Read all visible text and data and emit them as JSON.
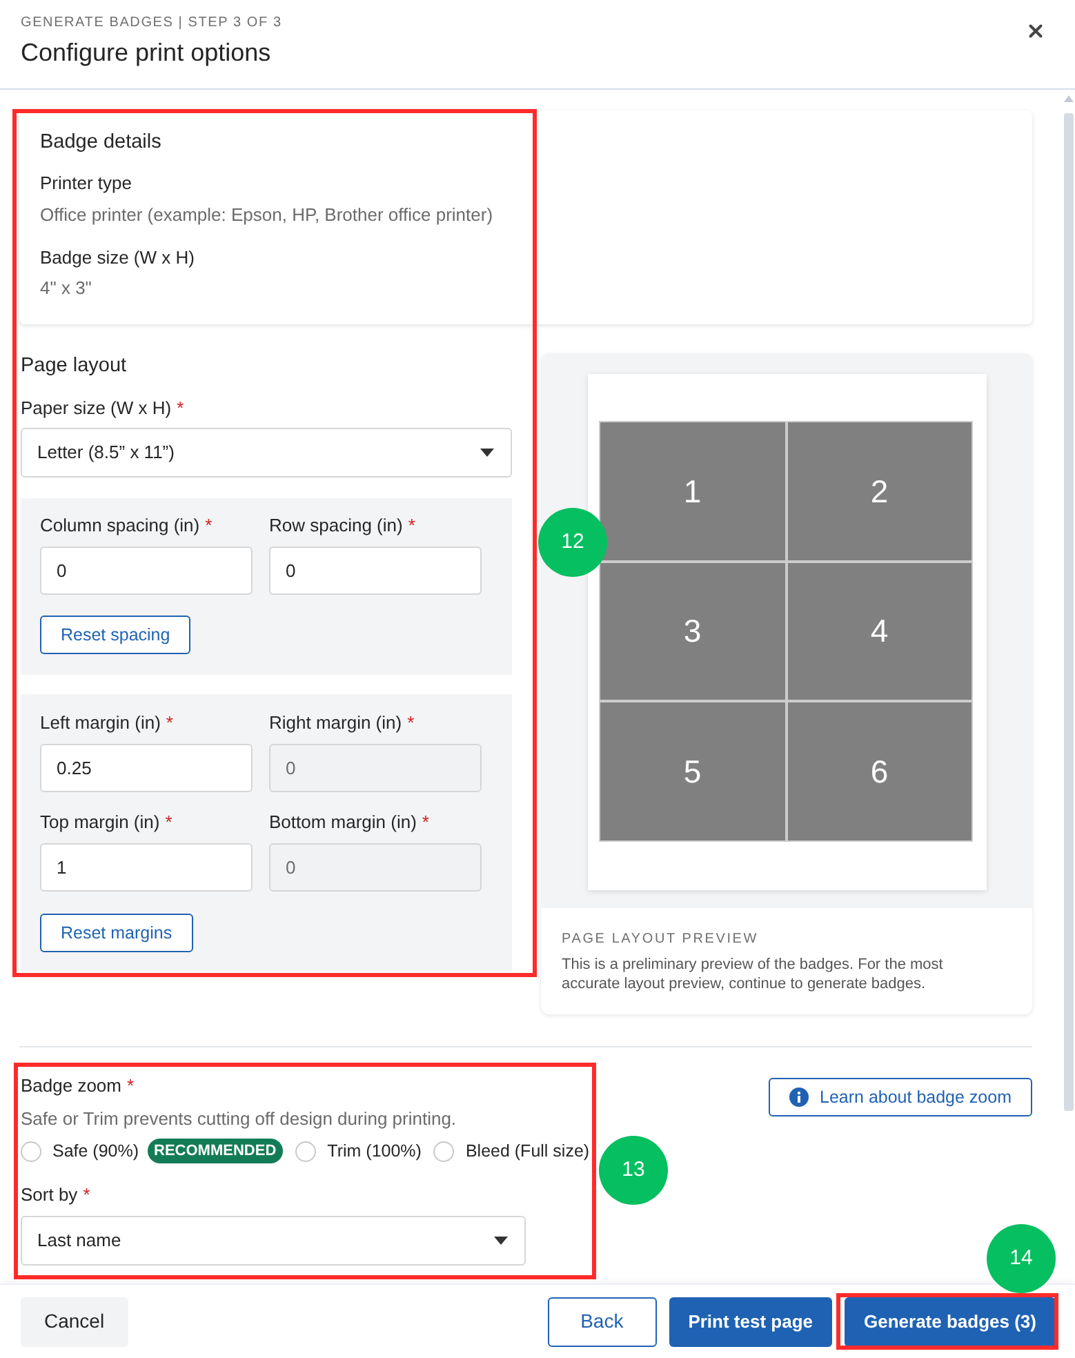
{
  "header": {
    "eyebrow": "GENERATE BADGES | STEP 3 OF 3",
    "title": "Configure print options"
  },
  "badge_details": {
    "title": "Badge details",
    "fields": [
      {
        "label": "Printer type",
        "value": "Office printer (example: Epson, HP, Brother office printer)"
      },
      {
        "label": "Badge size (W x H)",
        "value": "4\" x 3\""
      }
    ]
  },
  "page_layout": {
    "title": "Page layout",
    "paper_size": {
      "label": "Paper size (W x H)",
      "required_mark": "*",
      "value": "Letter (8.5” x 11”)"
    },
    "spacing_group": {
      "fields": [
        {
          "label": "Column spacing (in)",
          "required_mark": "*",
          "value": "0",
          "disabled": false
        },
        {
          "label": "Row spacing (in)",
          "required_mark": "*",
          "value": "0",
          "disabled": false
        }
      ],
      "reset_button": "Reset spacing"
    },
    "margin_group": {
      "fields": [
        {
          "label": "Left margin (in)",
          "required_mark": "*",
          "value": "0.25",
          "disabled": false
        },
        {
          "label": "Right margin (in)",
          "required_mark": "*",
          "value": "0",
          "disabled": true
        },
        {
          "label": "Top margin (in)",
          "required_mark": "*",
          "value": "1",
          "disabled": false
        },
        {
          "label": "Bottom margin (in)",
          "required_mark": "*",
          "value": "0",
          "disabled": true
        }
      ],
      "reset_button": "Reset margins"
    }
  },
  "preview": {
    "cells": [
      "1",
      "2",
      "3",
      "4",
      "5",
      "6"
    ],
    "caption_title": "PAGE LAYOUT PREVIEW",
    "caption": "This is a preliminary preview of the badges. For the most accurate layout preview, continue to generate badges."
  },
  "badge_zoom": {
    "label": "Badge zoom",
    "required_mark": "*",
    "hint": "Safe or Trim prevents cutting off design during printing.",
    "options": [
      {
        "label": "Safe (90%)",
        "selected": false,
        "tag": "RECOMMENDED"
      },
      {
        "label": "Trim (100%)",
        "selected": false
      },
      {
        "label": "Bleed (Full size)",
        "selected": false
      }
    ],
    "learn_button": "Learn about badge zoom"
  },
  "sort_by": {
    "label": "Sort by",
    "required_mark": "*",
    "value": "Last name"
  },
  "footer": {
    "buttons": [
      {
        "label": "Cancel",
        "kind": "secondary"
      },
      {
        "label": "Back",
        "kind": "outline"
      },
      {
        "label": "Print test page",
        "kind": "primary"
      },
      {
        "label": "Generate badges (3)",
        "kind": "primary"
      }
    ]
  },
  "callouts": [
    {
      "label": "12"
    },
    {
      "label": "13"
    },
    {
      "label": "14"
    }
  ]
}
